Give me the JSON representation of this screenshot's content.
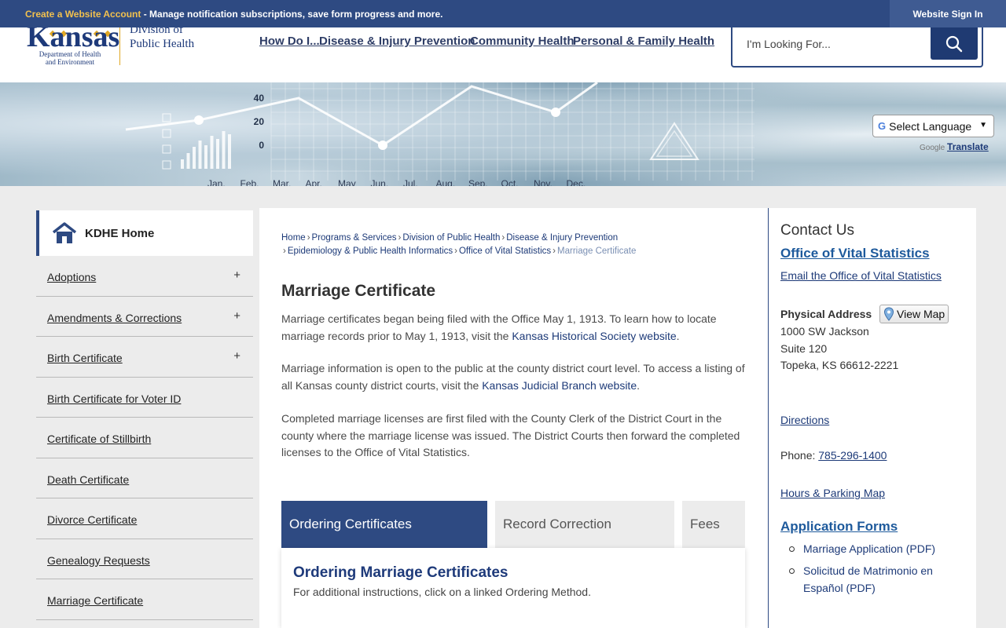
{
  "topbar": {
    "create_label": "Create a Website Account",
    "message": " - Manage notification subscriptions, save form progress and more.",
    "signin_label": "Website Sign In"
  },
  "logo": {
    "state": "Kansas",
    "dept_line1": "Department of Health",
    "dept_line2": "and Environment",
    "division_line1": "Division of",
    "division_line2": "Public Health"
  },
  "nav": [
    "How Do I...",
    "Disease & Injury Prevention",
    "Community Health",
    "Personal & Family Health"
  ],
  "search": {
    "placeholder": "I'm Looking For..."
  },
  "banner": {
    "y_ticks": [
      "40",
      "20",
      "0"
    ],
    "months": [
      "Jan.",
      "Feb.",
      "Mar.",
      "Apr.",
      "May",
      "Jun.",
      "Jul.",
      "Aug.",
      "Sep.",
      "Oct.",
      "Nov.",
      "Dec."
    ]
  },
  "translate": {
    "select_label": "Select Language",
    "powered_by": "Google",
    "translate_label": "Translate"
  },
  "sidebar": {
    "home_label": "KDHE Home",
    "items": [
      {
        "label": "Adoptions",
        "expand": "+"
      },
      {
        "label": "Amendments & Corrections",
        "expand": "+"
      },
      {
        "label": "Birth Certificate",
        "expand": "+"
      },
      {
        "label": "Birth Certificate for Voter ID",
        "expand": ""
      },
      {
        "label": "Certificate of Stillbirth",
        "expand": ""
      },
      {
        "label": "Death Certificate",
        "expand": ""
      },
      {
        "label": "Divorce Certificate",
        "expand": ""
      },
      {
        "label": "Genealogy Requests",
        "expand": ""
      },
      {
        "label": "Marriage Certificate",
        "expand": ""
      }
    ]
  },
  "breadcrumb": {
    "items": [
      "Home",
      "Programs & Services",
      "Division of Public Health",
      "Disease & Injury Prevention",
      "Epidemiology & Public Health Informatics",
      "Office of Vital Statistics",
      "Marriage Certificate"
    ],
    "separator": "›"
  },
  "main": {
    "title": "Marriage Certificate",
    "p1_before": "Marriage certificates began being filed with the Office May 1, 1913. To learn how to locate marriage records prior to May 1, 1913, visit the ",
    "p1_link": "Kansas Historical Society website",
    "p1_after": ".",
    "p2_before": "Marriage information is open to the public at the county district court level. To access a listing of all Kansas county district courts, visit the ",
    "p2_link": "Kansas Judicial Branch website",
    "p2_after": ".",
    "p3": "Completed marriage licenses are first filed with the County Clerk of the District Court in the county where the marriage license was issued. The District Courts then forward the completed licenses to the Office of Vital Statistics."
  },
  "tabs": {
    "items": [
      "Ordering Certificates",
      "Record Correction",
      "Fees"
    ],
    "active_index": 0,
    "panel_heading": "Ordering Marriage Certificates",
    "panel_text": "For additional instructions, click on a linked Ordering Method."
  },
  "contact": {
    "title": "Contact Us",
    "office": "Office of Vital Statistics",
    "email_label": "Email the Office of Vital Statistics",
    "address_label": "Physical Address",
    "map_button": "View Map",
    "address_line1": "1000 SW Jackson",
    "address_line2": "Suite 120",
    "address_line3": "Topeka, KS 66612-2221",
    "directions": "Directions",
    "phone_label": "Phone: ",
    "phone": "785-296-1400",
    "hours": "Hours & Parking Map",
    "forms_heading": "Application Forms",
    "forms": [
      "Marriage Application (PDF)",
      "Solicitud de Matrimonio en Español (PDF)"
    ]
  },
  "colors": {
    "brand_navy": "#2e4a82",
    "gold": "#f2c14e",
    "link": "#1d3a78"
  }
}
